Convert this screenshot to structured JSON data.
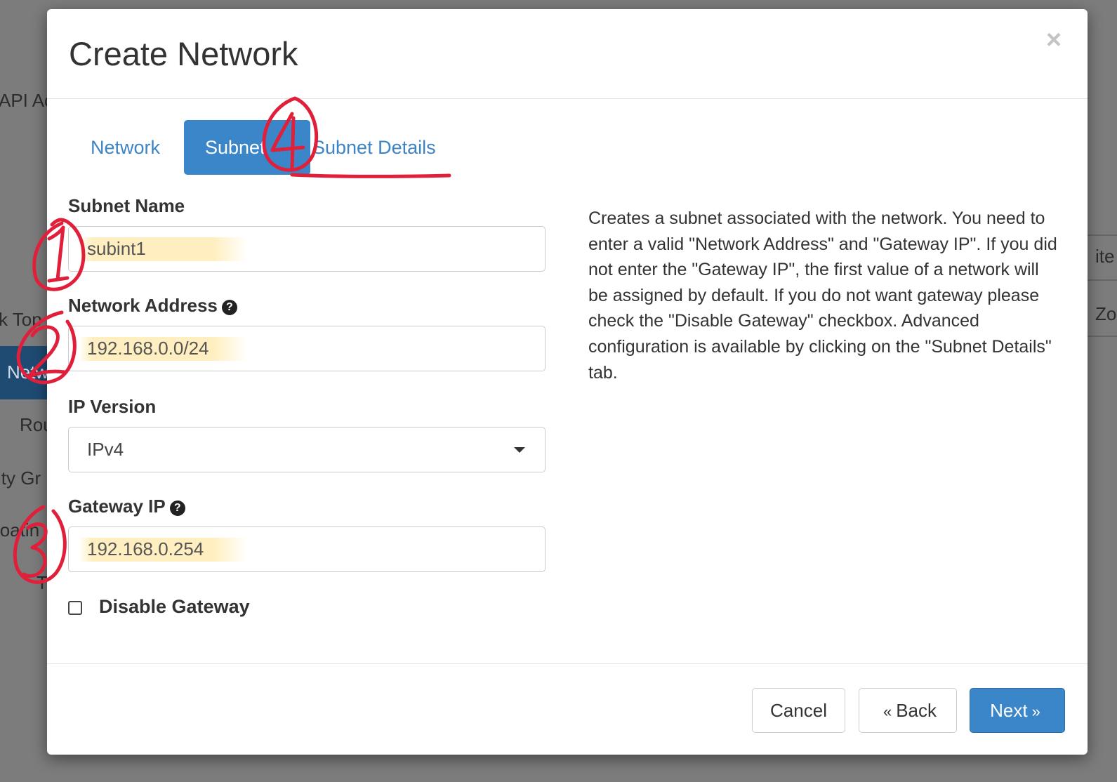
{
  "background": {
    "fragments": [
      "API Ac",
      "k Top",
      "Netw",
      "Rou",
      "ity Gr",
      "loatin",
      "T",
      "ite",
      "Zo"
    ]
  },
  "modal": {
    "title": "Create Network",
    "close_symbol": "×",
    "tabs": [
      {
        "label": "Network",
        "active": false
      },
      {
        "label": "Subnet",
        "active": true
      },
      {
        "label": "Subnet Details",
        "active": false
      }
    ],
    "fields": {
      "subnet_name": {
        "label": "Subnet Name",
        "value": "subint1"
      },
      "network_address": {
        "label": "Network Address",
        "value": "192.168.0.0/24",
        "help_icon": "question-circle-icon"
      },
      "ip_version": {
        "label": "IP Version",
        "selected": "IPv4"
      },
      "gateway_ip": {
        "label": "Gateway IP",
        "value": "192.168.0.254",
        "help_icon": "question-circle-icon"
      },
      "disable_gateway": {
        "label": "Disable Gateway",
        "checked": false
      }
    },
    "help_text": "Creates a subnet associated with the network. You need to enter a valid \"Network Address\" and \"Gateway IP\". If you did not enter the \"Gateway IP\", the first value of a network will be assigned by default. If you do not want gateway please check the \"Disable Gateway\" checkbox. Advanced configuration is available by clicking on the \"Subnet Details\" tab.",
    "buttons": {
      "cancel": "Cancel",
      "back": "Back",
      "back_glyph": "«",
      "next": "Next",
      "next_glyph": "»"
    }
  },
  "annotations": {
    "markers": [
      "1",
      "2",
      "3",
      "4"
    ],
    "color": "#e0203a"
  },
  "colors": {
    "primary": "#3a86c8",
    "highlight": "#ffe18c"
  }
}
